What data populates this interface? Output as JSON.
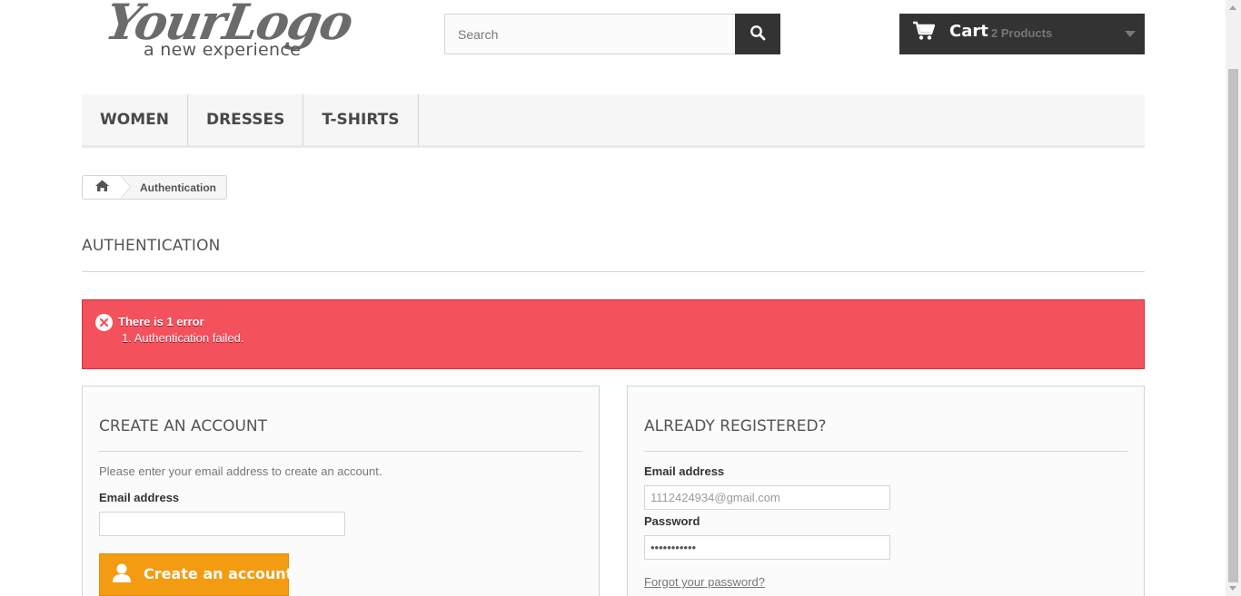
{
  "header": {
    "logo": {
      "main": "YourLogo",
      "tagline": "a new experience"
    },
    "search": {
      "placeholder": "Search",
      "value": ""
    },
    "cart": {
      "label": "Cart",
      "count": "2 Products"
    }
  },
  "menu": {
    "items": [
      {
        "label": "WOMEN"
      },
      {
        "label": "DRESSES"
      },
      {
        "label": "T-SHIRTS"
      }
    ]
  },
  "breadcrumb": {
    "current": "Authentication"
  },
  "page": {
    "heading": "AUTHENTICATION"
  },
  "alert": {
    "title": "There is 1 error",
    "items": [
      "1. Authentication failed."
    ],
    "color": "#f3515c"
  },
  "create_account": {
    "title": "CREATE AN ACCOUNT",
    "description": "Please enter your email address to create an account.",
    "email_label": "Email address",
    "email_value": "",
    "button_label": "Create an account",
    "button_color": "#f39c11"
  },
  "login": {
    "title": "ALREADY REGISTERED?",
    "email_label": "Email address",
    "email_value": "1112424934@gmail.com",
    "password_label": "Password",
    "password_value": "•••••••••••",
    "forgot_label": "Forgot your password?"
  },
  "icons": {
    "search": "search-icon",
    "cart": "cart-icon",
    "home": "home-icon",
    "error": "close-circle-icon",
    "user": "user-icon"
  }
}
